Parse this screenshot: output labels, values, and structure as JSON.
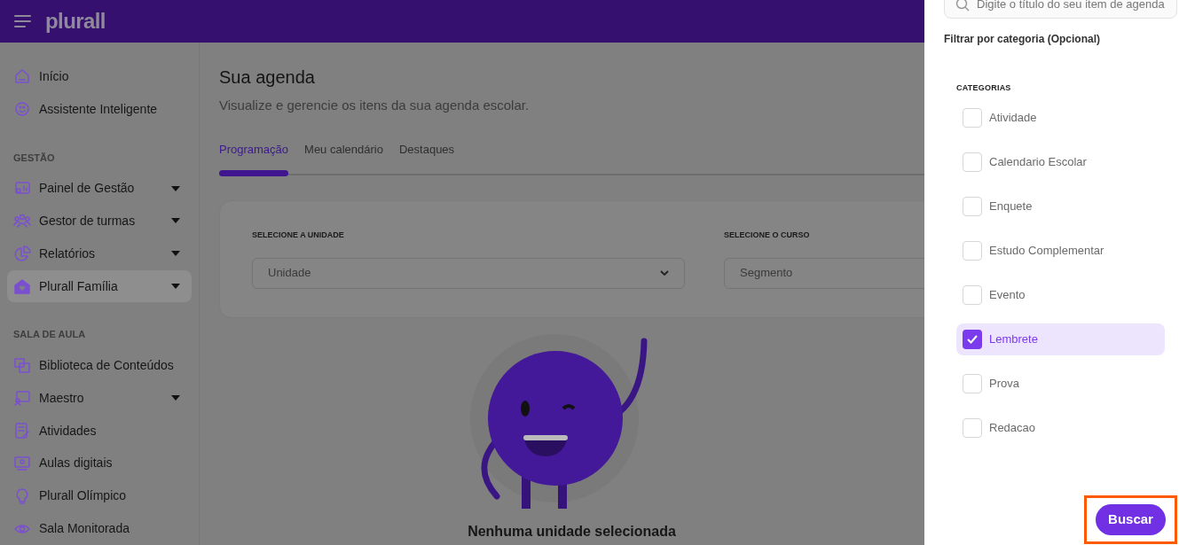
{
  "header": {
    "logo": "plurall"
  },
  "sidebar": {
    "sections": [
      {
        "items": [
          {
            "label": "Início",
            "expandable": false,
            "selected": false
          },
          {
            "label": "Assistente Inteligente",
            "expandable": false,
            "selected": false
          }
        ]
      },
      {
        "title": "GESTÃO",
        "items": [
          {
            "label": "Painel de Gestão",
            "expandable": true,
            "selected": false
          },
          {
            "label": "Gestor de turmas",
            "expandable": true,
            "selected": false
          },
          {
            "label": "Relatórios",
            "expandable": true,
            "selected": false
          },
          {
            "label": "Plurall Família",
            "expandable": true,
            "selected": true
          }
        ]
      },
      {
        "title": "SALA DE AULA",
        "items": [
          {
            "label": "Biblioteca de Conteúdos",
            "expandable": false,
            "selected": false
          },
          {
            "label": "Maestro",
            "expandable": true,
            "selected": false
          },
          {
            "label": "Atividades",
            "expandable": false,
            "selected": false
          },
          {
            "label": "Aulas digitais",
            "expandable": false,
            "selected": false
          },
          {
            "label": "Plurall Olímpico",
            "expandable": false,
            "selected": false
          },
          {
            "label": "Sala Monitorada",
            "expandable": false,
            "selected": false
          }
        ]
      }
    ]
  },
  "main": {
    "title": "Sua agenda",
    "subtitle": "Visualize e gerencie os itens da sua agenda escolar.",
    "tabs": [
      {
        "label": "Programação",
        "selected": true
      },
      {
        "label": "Meu calendário",
        "selected": false
      },
      {
        "label": "Destaques",
        "selected": false
      }
    ],
    "filters": [
      {
        "label": "SELECIONE A UNIDADE",
        "placeholder": "Unidade"
      },
      {
        "label": "SELECIONE O CURSO",
        "placeholder": "Segmento"
      }
    ],
    "empty_state": {
      "message": "Nenhuma unidade selecionada"
    }
  },
  "filter_panel": {
    "search": {
      "placeholder": "Digite o título do seu item de agenda"
    },
    "title": "Filtrar por categoria (Opcional)",
    "group_label": "CATEGORIAS",
    "categories": [
      {
        "label": "Atividade",
        "checked": false
      },
      {
        "label": "Calendario Escolar",
        "checked": false
      },
      {
        "label": "Enquete",
        "checked": false
      },
      {
        "label": "Estudo Complementar",
        "checked": false
      },
      {
        "label": "Evento",
        "checked": false
      },
      {
        "label": "Lembrete",
        "checked": true
      },
      {
        "label": "Prova",
        "checked": false
      },
      {
        "label": "Redacao",
        "checked": false
      }
    ],
    "button": "Buscar"
  }
}
